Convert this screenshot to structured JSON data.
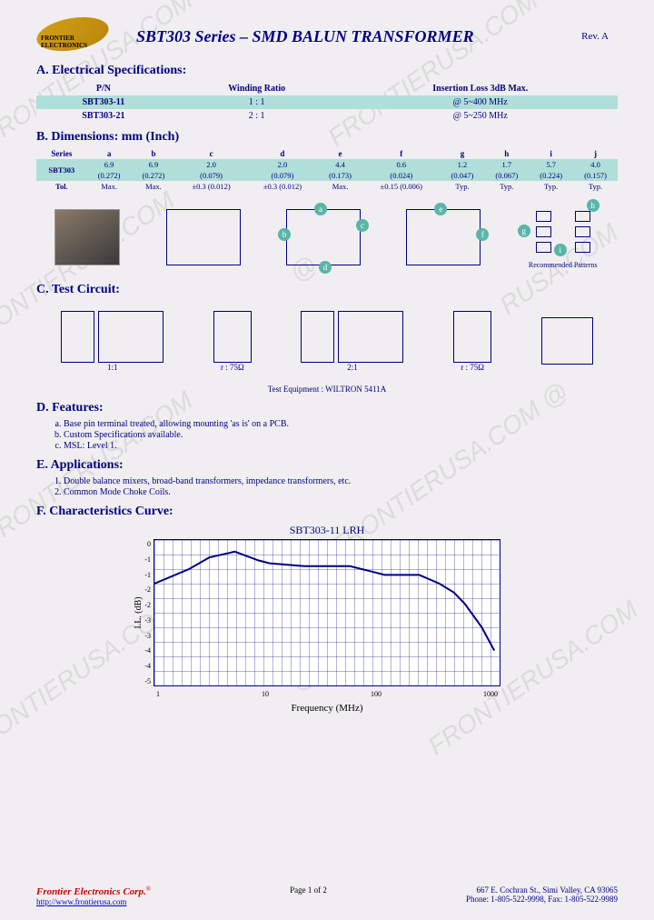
{
  "header": {
    "logo_name": "FRONTIER ELECTRONICS",
    "title": "SBT303 Series – SMD BALUN TRANSFORMER",
    "rev": "Rev. A"
  },
  "sections": {
    "a": "A. Electrical Specifications:",
    "b": "B. Dimensions: mm (Inch)",
    "c": "C. Test Circuit:",
    "d": "D. Features:",
    "e": "E. Applications:",
    "f": "F. Characteristics Curve:"
  },
  "electrical": {
    "headers": [
      "P/N",
      "Winding Ratio",
      "Insertion Loss 3dB Max."
    ],
    "rows": [
      {
        "pn": "SBT303-11",
        "ratio": "1 : 1",
        "loss": "@ 5~400 MHz"
      },
      {
        "pn": "SBT303-21",
        "ratio": "2 : 1",
        "loss": "@ 5~250 MHz"
      }
    ]
  },
  "dimensions": {
    "cols": [
      "Series",
      "a",
      "b",
      "c",
      "d",
      "e",
      "f",
      "g",
      "h",
      "i",
      "j"
    ],
    "series": "SBT303",
    "mm": [
      "6.9",
      "6.9",
      "2.0",
      "2.0",
      "4.4",
      "0.6",
      "1.2",
      "1.7",
      "5.7",
      "4.0"
    ],
    "inch": [
      "(0.272)",
      "(0.272)",
      "(0.079)",
      "(0.079)",
      "(0.173)",
      "(0.024)",
      "(0.047)",
      "(0.067)",
      "(0.224)",
      "(0.157)"
    ],
    "tol_label": "Tol.",
    "tol": [
      "Max.",
      "Max.",
      "±0.3 (0.012)",
      "±0.3 (0.012)",
      "Max.",
      "±0.15 (0.006)",
      "Typ.",
      "Typ.",
      "Typ.",
      "Typ."
    ]
  },
  "diagrams": {
    "recommended": "Recommended Patterns",
    "badges": [
      "a",
      "b",
      "c",
      "d",
      "e",
      "f",
      "g",
      "h",
      "i"
    ]
  },
  "test_circuit": {
    "labels": [
      "1:1",
      "r : 75Ω",
      "2:1",
      "r : 75Ω"
    ],
    "test_equipment": "Test Equipment : WILTRON 5411A"
  },
  "features": [
    "Base pin terminal treated, allowing mounting 'as is' on a PCB.",
    "Custom Specifications available.",
    "MSL: Level 1."
  ],
  "applications": [
    "Double balance mixers, broad-band transformers, impedance transformers, etc.",
    "Common Mode Choke Coils."
  ],
  "chart_data": {
    "type": "line",
    "title": "SBT303-11 LRH",
    "xlabel": "Frequency (MHz)",
    "ylabel": "I.L. (dB)",
    "x_scale": "log",
    "xlim": [
      1,
      1000
    ],
    "ylim": [
      -5,
      0
    ],
    "x_ticks": [
      "1",
      "10",
      "100",
      "1000"
    ],
    "y_ticks": [
      "0",
      "-1",
      "-1",
      "-2",
      "-2",
      "-3",
      "-3",
      "-4",
      "-4",
      "-5"
    ],
    "series": [
      {
        "name": "Insertion Loss",
        "x": [
          1,
          2,
          3,
          5,
          8,
          10,
          20,
          50,
          80,
          100,
          150,
          200,
          300,
          400,
          500,
          700,
          900
        ],
        "y": [
          -1.5,
          -1.0,
          -0.6,
          -0.4,
          -0.7,
          -0.8,
          -0.9,
          -0.9,
          -1.1,
          -1.2,
          -1.2,
          -1.2,
          -1.5,
          -1.8,
          -2.2,
          -3.0,
          -3.8
        ]
      }
    ]
  },
  "footer": {
    "corp": "Frontier Electronics Corp.",
    "tm": "®",
    "url": "http://www.frontierusa.com",
    "page": "Page 1 of 2",
    "addr": "667 E. Cochran St., Simi Valley, CA 93065",
    "phone": "Phone: 1-805-522-9998, Fax: 1-805-522-9989"
  }
}
